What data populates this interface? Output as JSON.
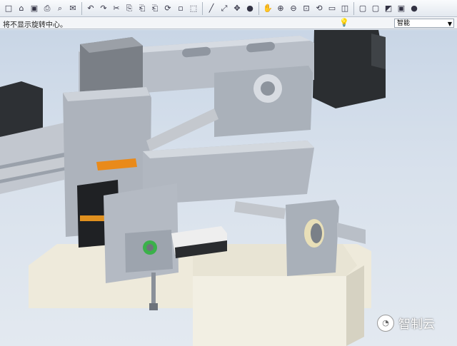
{
  "toolbar": {
    "icons": [
      "new-file-icon",
      "open-folder-icon",
      "save-icon",
      "print-icon",
      "print-preview-icon",
      "email-icon",
      "undo-icon",
      "redo-icon",
      "cut-icon",
      "copy-icon",
      "paste-icon",
      "paste-special-icon",
      "regenerate-icon",
      "find-icon",
      "select-box-icon",
      "sketch-icon",
      "datum-axis-icon",
      "spin-center-icon",
      "render-sphere-icon",
      "pan-icon",
      "zoom-in-icon",
      "zoom-out-icon",
      "refit-icon",
      "reorient-icon",
      "saved-views-icon",
      "layers-icon",
      "wireframe-icon",
      "hidden-line-icon",
      "no-hidden-icon",
      "shaded-icon",
      "appearance-icon"
    ],
    "glyphs": [
      "□",
      "⌂",
      "▣",
      "⎙",
      "⌕",
      "✉",
      "↶",
      "↷",
      "✂",
      "⎘",
      "⎗",
      "⎗",
      "⟳",
      "▫",
      "⬚",
      "╱",
      "⤢",
      "✥",
      "●",
      "✋",
      "⊕",
      "⊖",
      "⊡",
      "⟲",
      "▭",
      "◫",
      "▢",
      "▢",
      "◩",
      "▣",
      "●"
    ]
  },
  "status": {
    "message": "将不显示旋转中心。",
    "filter_value": "智能"
  },
  "watermark": {
    "text": "智制云"
  }
}
